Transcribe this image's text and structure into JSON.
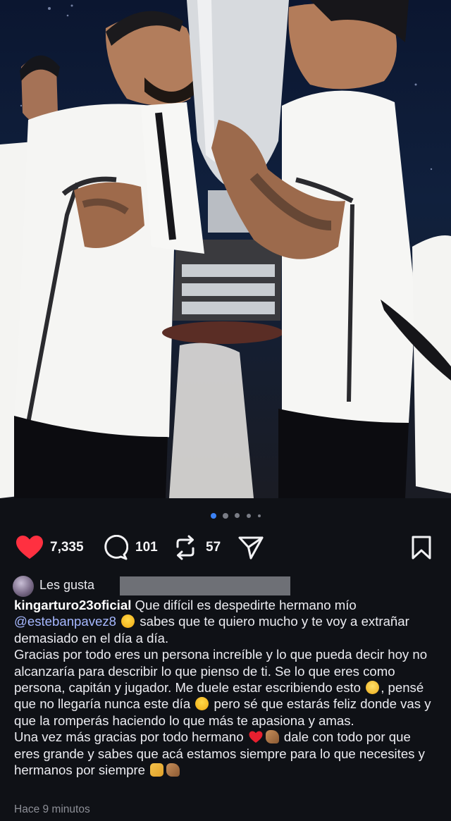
{
  "post": {
    "carousel": {
      "total": 5,
      "active": 1
    },
    "stats": {
      "likes": "7,335",
      "comments": "101",
      "reposts": "57"
    },
    "icons": {
      "like": "heart-filled-icon",
      "comment": "comment-bubble-icon",
      "repost": "repost-arrows-icon",
      "share": "paper-plane-icon",
      "save": "bookmark-icon"
    },
    "colors": {
      "like": "#ff3040",
      "background": "#0f1116",
      "mention": "#a6b8ff"
    },
    "liked_by": {
      "label": "Les gusta"
    },
    "caption": {
      "username": "kingarturo23oficial",
      "line1": " Que difícil es despedirte hermano mío",
      "mention": "@estebanpavez8",
      "line2": " sabes que te quiero mucho y te voy a extrañar demasiado en el día a día.",
      "para2_a": "Gracias por todo eres un persona increíble y lo que pueda decir hoy no alcanzaría para describir lo que pienso de ti. Se lo que eres como persona, capitán y jugador. Me duele estar escribiendo esto",
      "para2_b": ", pensé que no llegaría nunca este día",
      "para2_c": "pero sé que estarás feliz donde vas y que la romperás haciendo lo que más te apasiona y amas.",
      "para3_a": "Una vez más gracias por todo hermano",
      "para3_b": " dale con todo por que eres grande y sabes que acá estamos siempre para lo que necesites y hermanos por siempre"
    },
    "timestamp": "Hace 9 minutos"
  }
}
